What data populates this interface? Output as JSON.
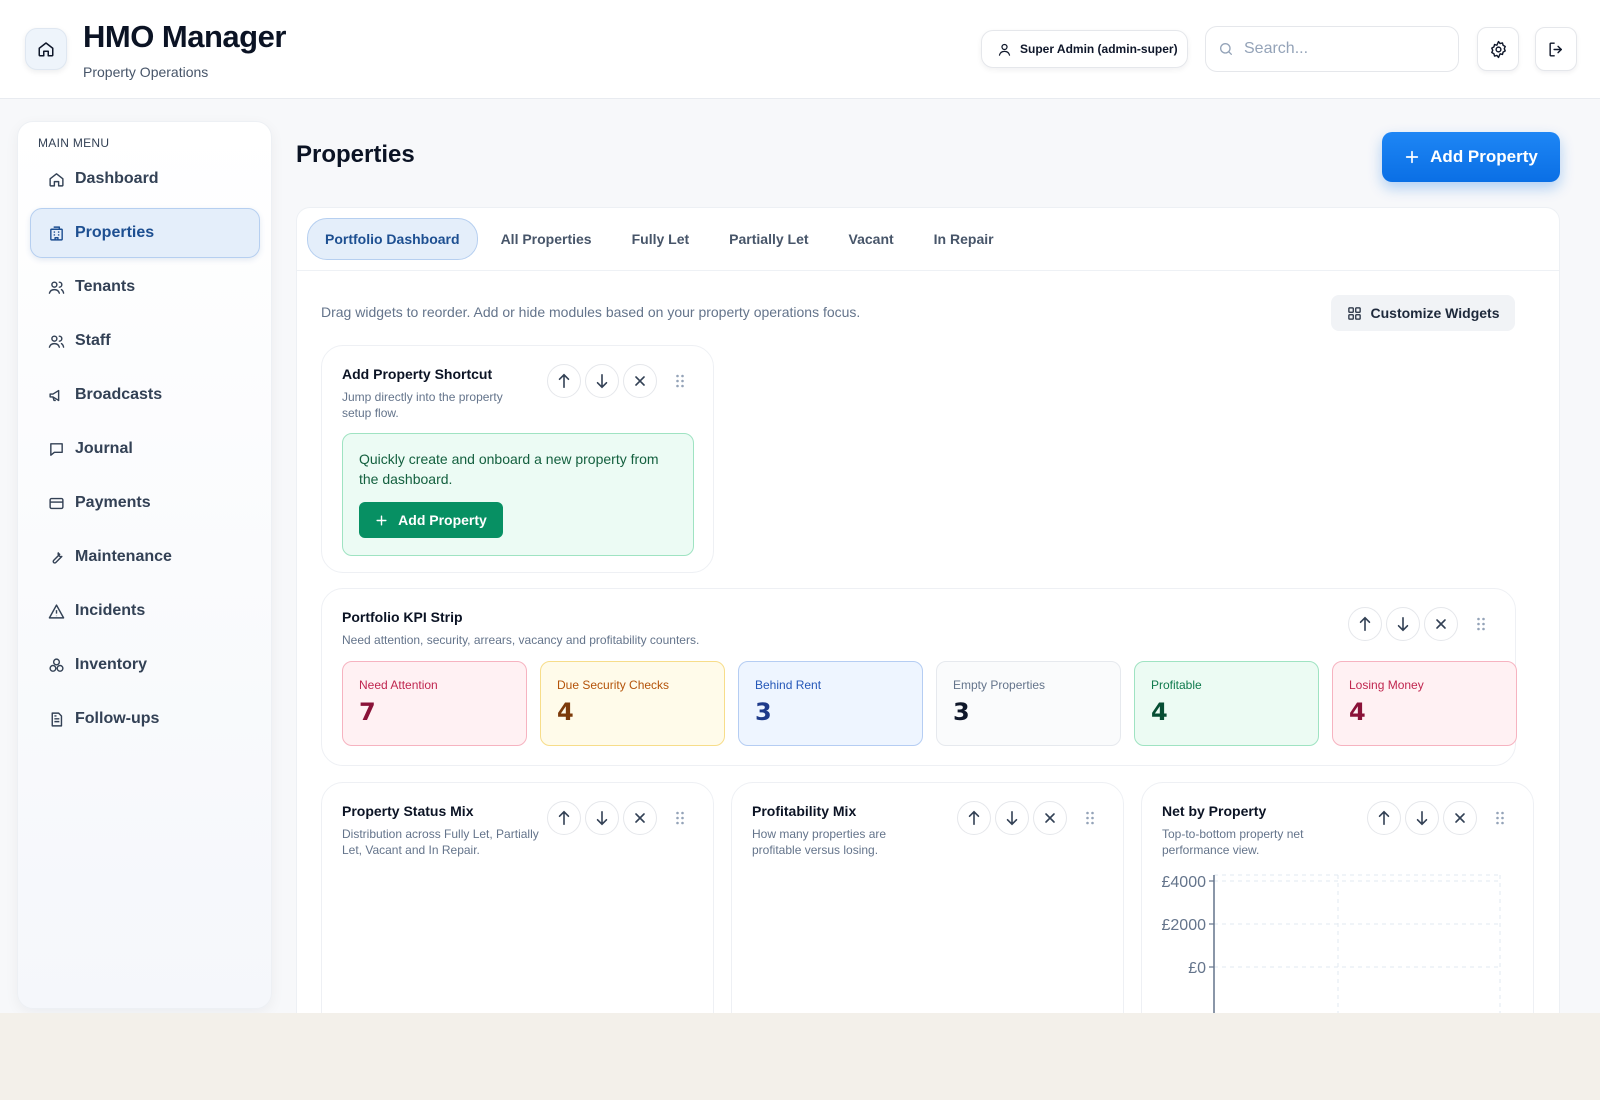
{
  "header": {
    "title": "HMO Manager",
    "subtitle": "Property Operations",
    "user_label": "Super Admin (admin-super)",
    "search_placeholder": "Search...",
    "search_value": ""
  },
  "sidebar": {
    "heading": "MAIN MENU",
    "items": [
      {
        "label": "Dashboard",
        "icon": "home-icon",
        "active": false
      },
      {
        "label": "Properties",
        "icon": "building-icon",
        "active": true
      },
      {
        "label": "Tenants",
        "icon": "users-icon",
        "active": false
      },
      {
        "label": "Staff",
        "icon": "users-icon",
        "active": false
      },
      {
        "label": "Broadcasts",
        "icon": "megaphone-icon",
        "active": false
      },
      {
        "label": "Journal",
        "icon": "chat-icon",
        "active": false
      },
      {
        "label": "Payments",
        "icon": "card-icon",
        "active": false
      },
      {
        "label": "Maintenance",
        "icon": "wrench-icon",
        "active": false
      },
      {
        "label": "Incidents",
        "icon": "warning-icon",
        "active": false
      },
      {
        "label": "Inventory",
        "icon": "boxes-icon",
        "active": false
      },
      {
        "label": "Follow-ups",
        "icon": "clipboard-icon",
        "active": false
      }
    ]
  },
  "main": {
    "title": "Properties",
    "add_button": "Add Property",
    "tabs": [
      {
        "label": "Portfolio Dashboard",
        "active": true
      },
      {
        "label": "All Properties",
        "active": false
      },
      {
        "label": "Fully Let",
        "active": false
      },
      {
        "label": "Partially Let",
        "active": false
      },
      {
        "label": "Vacant",
        "active": false
      },
      {
        "label": "In Repair",
        "active": false
      }
    ],
    "help_text": "Drag widgets to reorder. Add or hide modules based on your property operations focus.",
    "customize_button": "Customize Widgets"
  },
  "widgets": {
    "shortcut": {
      "title": "Add Property Shortcut",
      "description": "Jump directly into the property setup flow.",
      "body": "Quickly create and onboard a new property from the dashboard.",
      "button": "Add Property"
    },
    "kpi": {
      "title": "Portfolio KPI Strip",
      "description": "Need attention, security, arrears, vacancy and profitability counters.",
      "cards": [
        {
          "label": "Need Attention",
          "value": "7",
          "bg": "#fff1f3",
          "border": "#f6b3c0",
          "label_color": "#c0264f",
          "value_color": "#8a1238"
        },
        {
          "label": "Due Security Checks",
          "value": "4",
          "bg": "#fffbea",
          "border": "#f7dd8a",
          "label_color": "#b45309",
          "value_color": "#7c3a0a"
        },
        {
          "label": "Behind Rent",
          "value": "3",
          "bg": "#eef5ff",
          "border": "#b5cdf3",
          "label_color": "#2457b8",
          "value_color": "#1e3a8a"
        },
        {
          "label": "Empty Properties",
          "value": "3",
          "bg": "#fafbfc",
          "border": "#e6e9ee",
          "label_color": "#64748b",
          "value_color": "#0f172a"
        },
        {
          "label": "Profitable",
          "value": "4",
          "bg": "#ecfbf3",
          "border": "#9fe3c2",
          "label_color": "#0f7a4d",
          "value_color": "#064e33"
        },
        {
          "label": "Losing Money",
          "value": "4",
          "bg": "#fff1f3",
          "border": "#f6b3c0",
          "label_color": "#c0264f",
          "value_color": "#8a1238"
        }
      ]
    },
    "status_mix": {
      "title": "Property Status Mix",
      "description": "Distribution across Fully Let, Partially Let, Vacant and In Repair."
    },
    "profit_mix": {
      "title": "Profitability Mix",
      "description": "How many properties are profitable versus losing."
    },
    "net_by_property": {
      "title": "Net by Property",
      "description": "Top-to-bottom property net performance view."
    }
  },
  "chart_data": {
    "type": "bar",
    "title": "Net by Property",
    "y_ticks": [
      "£4000",
      "£2000",
      "£0"
    ],
    "tick_values": [
      4000,
      2000,
      0
    ],
    "grid": true
  },
  "colors": {
    "accent": "#0a6fe5",
    "success": "#079063",
    "active_nav": "#1d4f91"
  }
}
